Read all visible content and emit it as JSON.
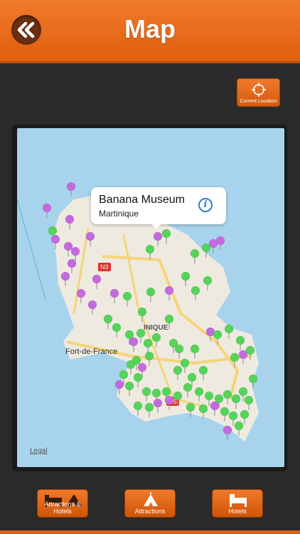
{
  "header": {
    "title": "Map",
    "back_icon": "double-chevron-left-icon"
  },
  "current_location": {
    "label": "Current Location",
    "icon": "crosshair-icon"
  },
  "map": {
    "place_labels": {
      "city": "Fort-de-France",
      "region": "INIQUE",
      "road_n3": "N3",
      "road_n5": "N5",
      "legal": "Legal"
    },
    "callout": {
      "title": "Banana Museum",
      "subtitle": "Martinique",
      "info_icon": "info-icon"
    },
    "pin_colors": {
      "attraction": "#55d45a",
      "hotel": "#c46adf"
    }
  },
  "footer": {
    "buttons": [
      {
        "label": "Attractions & Hotels",
        "icon": "bed-and-tent-icon"
      },
      {
        "label": "Attractions",
        "icon": "tent-icon"
      },
      {
        "label": "Hotels",
        "icon": "bed-icon"
      }
    ]
  },
  "colors": {
    "accent": "#e86a1a",
    "background": "#2a2a2b",
    "water": "#a7d4ec",
    "land": "#efeae0"
  }
}
